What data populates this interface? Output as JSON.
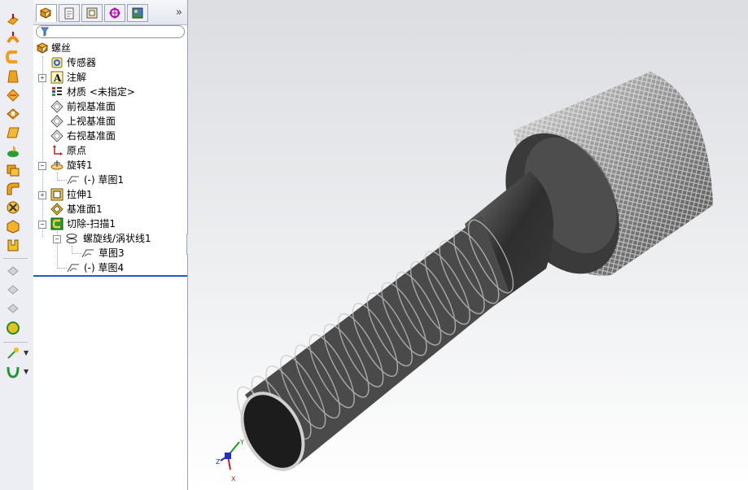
{
  "toolbar": {
    "icons": [
      "extrude-boss-icon",
      "revolve-boss-icon",
      "sweep-boss-icon",
      "loft-boss-icon",
      "boundary-boss-icon",
      "extrude-cut-icon",
      "plane-icon",
      "revolve-cut-icon",
      "sweep-cut-icon",
      "fillet-icon",
      "chamfer-icon",
      "rib-icon",
      "shell-icon",
      "draft-icon",
      "wrap-icon",
      "dome-icon",
      "reference-geometry-icon",
      "curves-icon"
    ]
  },
  "panel": {
    "tabs": [
      "feature-manager-tab",
      "property-manager-tab",
      "configuration-manager-tab",
      "dim-xpert-tab",
      "display-manager-tab"
    ],
    "expand_glyph": "»",
    "filter_placeholder": ""
  },
  "tree": {
    "root": "螺丝",
    "items": [
      {
        "label": "传感器",
        "icon": "sensor-icon"
      },
      {
        "label": "注解",
        "icon": "annotation-icon",
        "expander": "+"
      },
      {
        "label": "材质 <未指定>",
        "icon": "material-icon"
      },
      {
        "label": "前视基准面",
        "icon": "plane-icon"
      },
      {
        "label": "上视基准面",
        "icon": "plane-icon"
      },
      {
        "label": "右视基准面",
        "icon": "plane-icon"
      },
      {
        "label": "原点",
        "icon": "origin-icon"
      },
      {
        "label": "旋转1",
        "icon": "revolve-icon",
        "expander": "−"
      },
      {
        "label": "(-) 草图1",
        "icon": "sketch-icon"
      },
      {
        "label": "拉伸1",
        "icon": "extrude-icon",
        "expander": "+"
      },
      {
        "label": "基准面1",
        "icon": "plane-icon"
      },
      {
        "label": "切除-扫描1",
        "icon": "sweep-cut-icon",
        "expander": "−"
      },
      {
        "label": "螺旋线/涡状线1",
        "icon": "helix-icon",
        "expander": "−"
      },
      {
        "label": "草图3",
        "icon": "sketch-icon"
      },
      {
        "label": "(-) 草图4",
        "icon": "sketch-icon"
      }
    ]
  },
  "viewport": {
    "background_top": "#dcdde1",
    "background_bottom": "#ffffff",
    "axis_labels": {
      "x": "X",
      "y": "Y",
      "z": "Z"
    },
    "model": "screw-model"
  }
}
